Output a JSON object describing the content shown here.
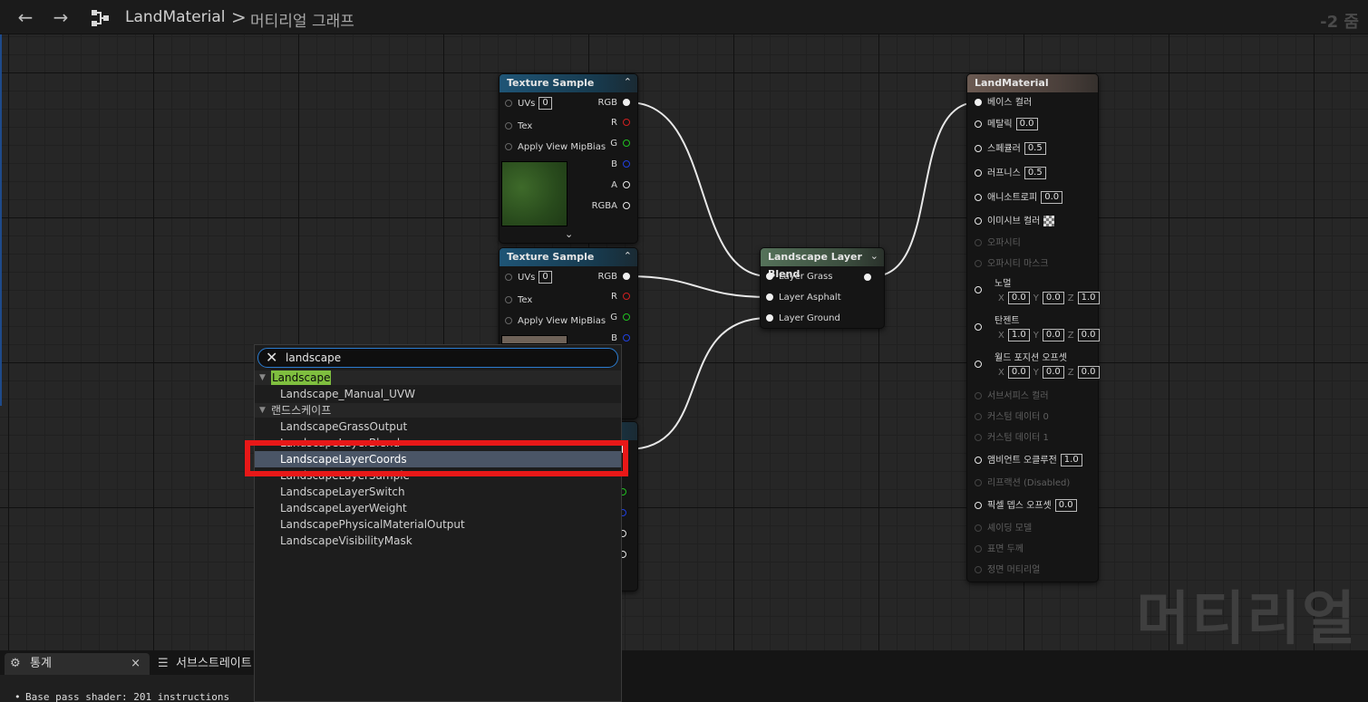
{
  "breadcrumb": {
    "root": "LandMaterial",
    "separator": ">",
    "current": "머티리얼 그래프"
  },
  "graph": {
    "zoom": "-2 줌",
    "watermark": "머티리얼"
  },
  "nodes": {
    "tex1": {
      "title": "Texture Sample",
      "inputs": [
        {
          "label": "UVs",
          "value": "0"
        },
        {
          "label": "Tex"
        },
        {
          "label": "Apply View MipBias"
        }
      ],
      "outputs": [
        "RGB",
        "R",
        "G",
        "B",
        "A",
        "RGBA"
      ],
      "expand_glyph": "⌄"
    },
    "tex2": {
      "title": "Texture Sample",
      "inputs": [
        {
          "label": "UVs",
          "value": "0"
        },
        {
          "label": "Tex"
        },
        {
          "label": "Apply View MipBias"
        }
      ],
      "outputs": [
        "RGB",
        "R",
        "G",
        "B"
      ]
    },
    "blend": {
      "title": "Landscape Layer Blend",
      "inputs": [
        "Layer Grass",
        "Layer Asphalt",
        "Layer Ground"
      ]
    },
    "result": {
      "title": "LandMaterial",
      "pins": [
        {
          "label": "베이스 컬러"
        },
        {
          "label": "메탈릭",
          "value": "0.0"
        },
        {
          "label": "스페큘러",
          "value": "0.5"
        },
        {
          "label": "러프니스",
          "value": "0.5"
        },
        {
          "label": "애니소트로피",
          "value": "0.0"
        },
        {
          "label": "이미시브 컬러"
        },
        {
          "label": "오파시티"
        },
        {
          "label": "오파시티 마스크"
        },
        {
          "label": "노멀",
          "x": "0.0",
          "y": "0.0",
          "z": "1.0"
        },
        {
          "label": "탄젠트",
          "x": "1.0",
          "y": "0.0",
          "z": "0.0"
        },
        {
          "label": "월드 포지션 오프셋",
          "x": "0.0",
          "y": "0.0",
          "z": "0.0"
        },
        {
          "label": "서브서피스 컬러"
        },
        {
          "label": "커스텀 데이터 0"
        },
        {
          "label": "커스텀 데이터 1"
        },
        {
          "label": "앰비언트 오클루전",
          "value": "1.0"
        },
        {
          "label": "리프랙션 (Disabled)"
        },
        {
          "label": "픽셀 뎁스 오프셋",
          "value": "0.0"
        },
        {
          "label": "셰이딩 모델"
        },
        {
          "label": "표면 두께"
        },
        {
          "label": "정면 머티리얼"
        }
      ],
      "axis_labels": {
        "x": "X",
        "y": "Y",
        "z": "Z"
      }
    }
  },
  "search": {
    "query": "landscape",
    "categories": [
      {
        "label": "Landscape",
        "items": [
          "Landscape_Manual_UVW"
        ]
      },
      {
        "label": "랜드스케이프",
        "items": [
          "LandscapeGrassOutput",
          "LandscapeLayerBlend",
          "LandscapeLayerCoords",
          "LandscapeLayerSample",
          "LandscapeLayerSwitch",
          "LandscapeLayerWeight",
          "LandscapePhysicalMaterialOutput",
          "LandscapeVisibilityMask"
        ]
      }
    ],
    "selected_item": "LandscapeLayerCoords"
  },
  "bottom_tabs": {
    "stats": {
      "label": "통계",
      "close": "×"
    },
    "substrate": {
      "label": "서브스트레이트"
    },
    "stats_line": "Base pass shader: 201 instructions"
  },
  "colors": {
    "accent_search": "#2b7cd0",
    "highlight_box": "#e81818",
    "category_highlight": "#7fbf3f",
    "selected_row": "#4a5566"
  }
}
